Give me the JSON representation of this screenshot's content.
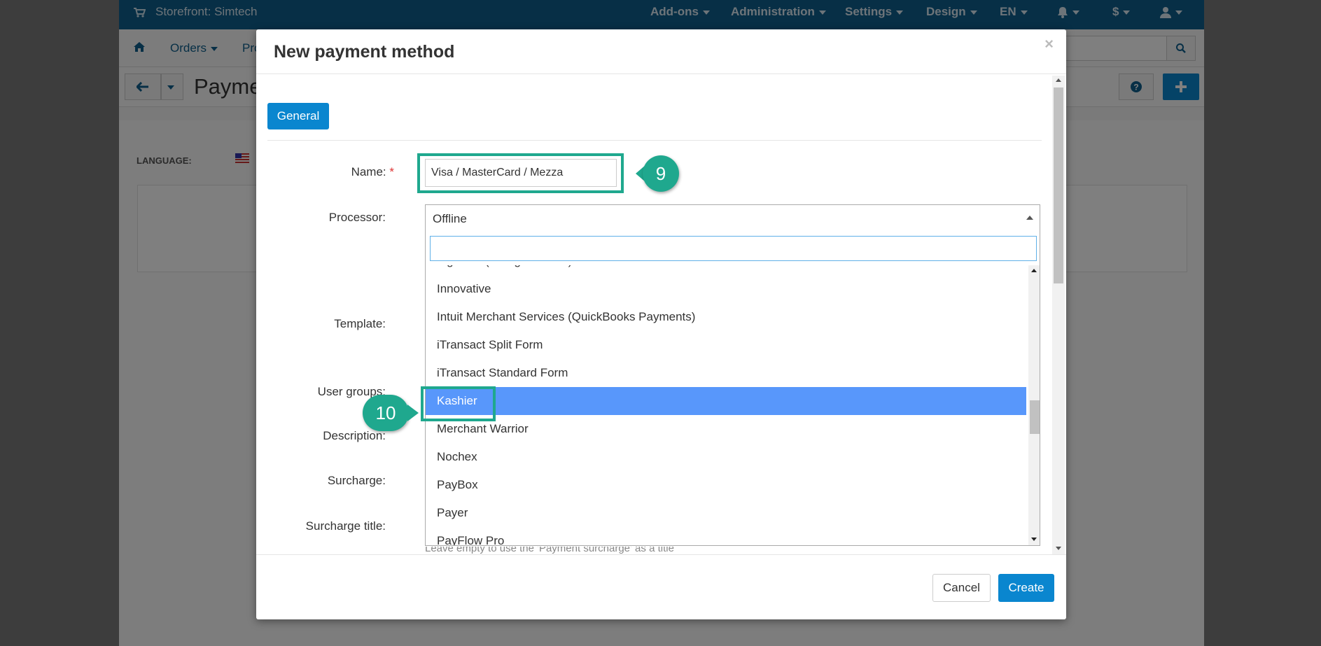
{
  "topbar": {
    "storefront": "Storefront: Simtech",
    "menu": [
      "Add-ons",
      "Administration",
      "Settings",
      "Design",
      "EN",
      "$"
    ]
  },
  "navbar": {
    "items": [
      "Orders",
      "Pro"
    ]
  },
  "page": {
    "title_fragment": "Payme",
    "language_label": "LANGUAGE:"
  },
  "modal": {
    "title": "New payment method",
    "close": "×",
    "tab_general": "General",
    "labels": {
      "name": "Name:",
      "required": "*",
      "processor": "Processor:",
      "template": "Template:",
      "user_groups": "User groups:",
      "description": "Description:",
      "surcharge": "Surcharge:",
      "surcharge_title": "Surcharge title:"
    },
    "name_value": "Visa / MasterCard / Mezza",
    "processor_selected": "Offline",
    "processor_search_value": "",
    "processor_options": [
      "Ingenico (ex Ogone Web)",
      "Innovative",
      "Intuit Merchant Services (QuickBooks Payments)",
      "iTransact Split Form",
      "iTransact Standard Form",
      "Kashier",
      "Merchant Warrior",
      "Nochex",
      "PayBox",
      "Payer",
      "PayFlow Pro"
    ],
    "highlighted_option": "Kashier",
    "surcharge_title_hint": "Leave empty to use the 'Payment surcharge' as a title",
    "cancel_label": "Cancel",
    "create_label": "Create"
  },
  "annotations": {
    "step_9": "9",
    "step_10": "10"
  },
  "colors": {
    "topbar": "#0e5f8d",
    "primary_button": "#0a86cf",
    "highlight_row": "#5897fb",
    "callout": "#1fa88e"
  }
}
